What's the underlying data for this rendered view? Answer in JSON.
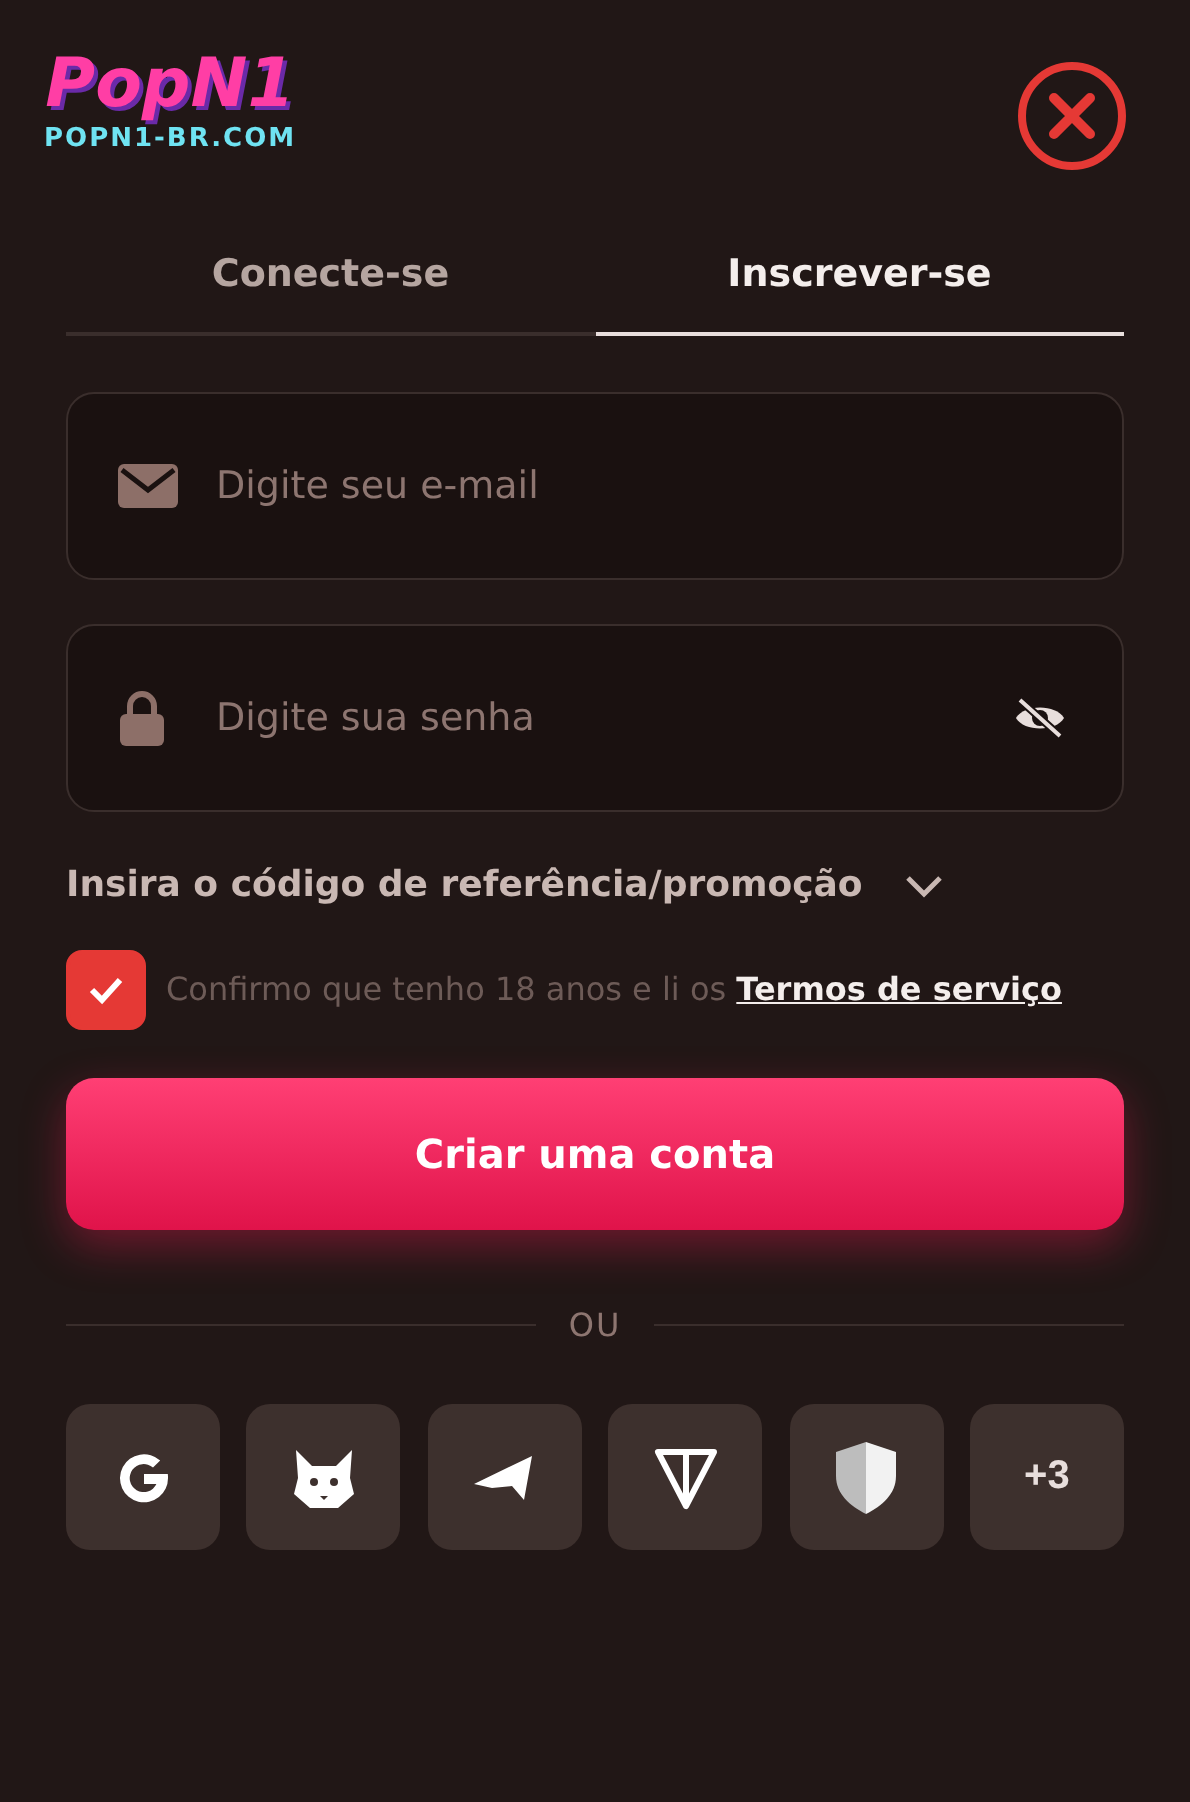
{
  "logo": {
    "title": "PopN1",
    "subtitle": "POPN1-BR.COM"
  },
  "tabs": [
    {
      "label": "Conecte-se",
      "selected": false
    },
    {
      "label": "Inscrever-se",
      "selected": true
    }
  ],
  "fields": [
    {
      "kind": "email",
      "placeholder": "Digite seu e-mail"
    },
    {
      "kind": "password",
      "placeholder": "Digite sua senha"
    }
  ],
  "promo": {
    "label": "Insira o código de referência/promoção",
    "expanded": false
  },
  "consent": {
    "checked": true,
    "text": "Confirmo que tenho 18 anos e li os",
    "link": "Termos de serviço"
  },
  "submit": "Criar uma conta",
  "divider": "OU",
  "social": [
    {
      "kind": "google"
    },
    {
      "kind": "fox"
    },
    {
      "kind": "telegram"
    },
    {
      "kind": "ton"
    },
    {
      "kind": "shield"
    },
    {
      "kind": "text",
      "label": "+3"
    }
  ]
}
